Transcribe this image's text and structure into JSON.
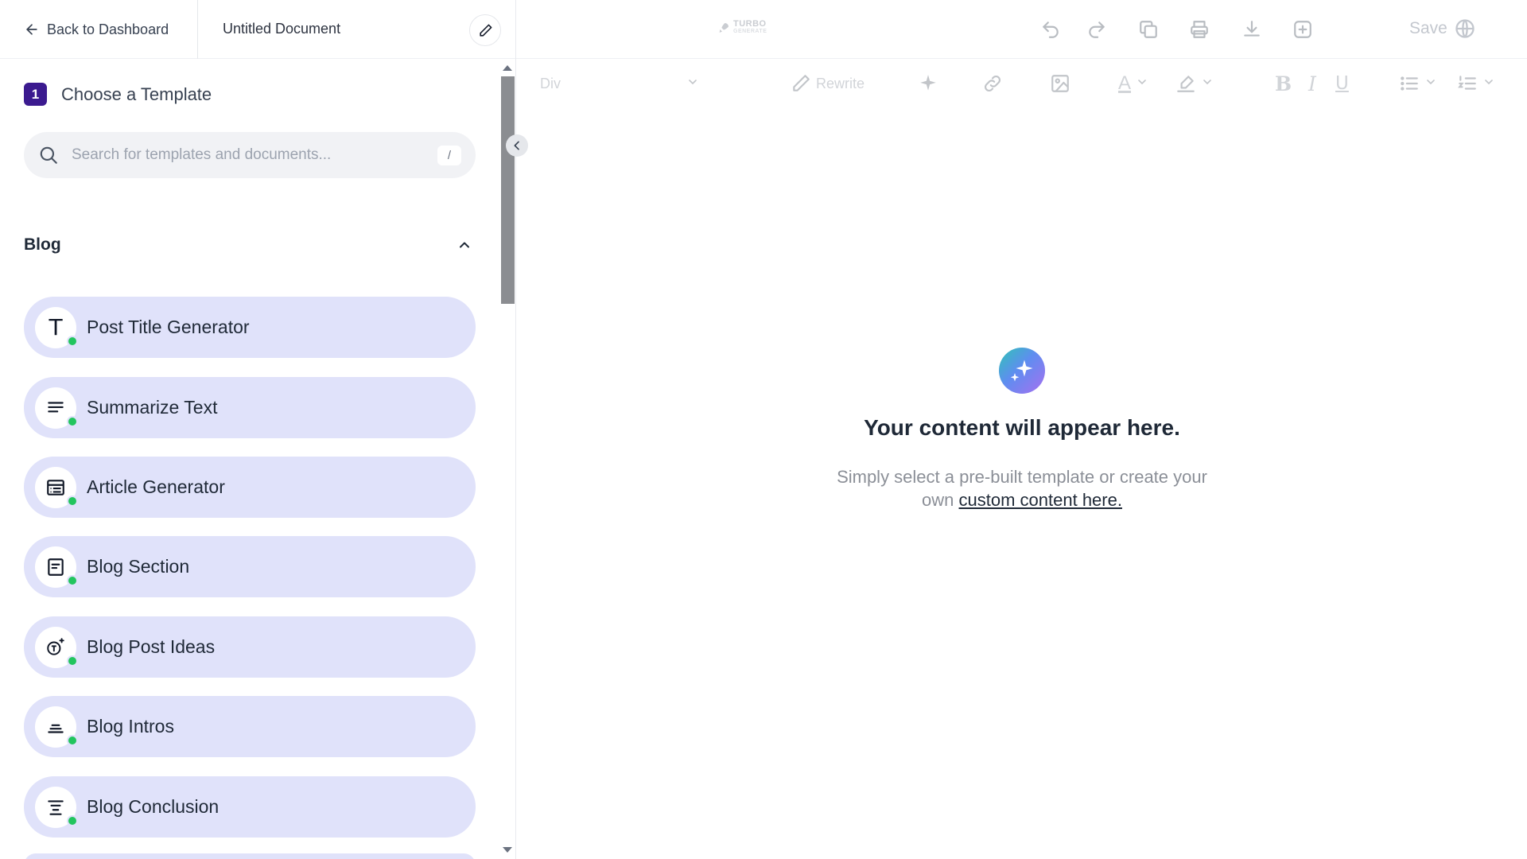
{
  "header": {
    "back_label": "Back to Dashboard",
    "document_title": "Untitled Document",
    "brand_line1": "TURBO",
    "brand_line2": "GENERATE",
    "save_label": "Save"
  },
  "toolbar": {
    "block_type": "Div",
    "rewrite_label": "Rewrite",
    "bold": "B",
    "italic": "I",
    "underline": "U",
    "text_color_glyph": "A"
  },
  "sidebar": {
    "step_number": "1",
    "step_title": "Choose a Template",
    "search_placeholder": "Search for templates and documents...",
    "search_shortcut": "/",
    "section_title": "Blog",
    "templates": [
      {
        "label": "Post Title Generator",
        "icon": "text-t-icon"
      },
      {
        "label": "Summarize Text",
        "icon": "align-lines-icon"
      },
      {
        "label": "Article Generator",
        "icon": "layout-icon"
      },
      {
        "label": "Blog Section",
        "icon": "document-section-icon"
      },
      {
        "label": "Blog Post Ideas",
        "icon": "sparkle-idea-icon"
      },
      {
        "label": "Blog Intros",
        "icon": "intro-lines-icon"
      },
      {
        "label": "Blog Conclusion",
        "icon": "filter-lines-icon"
      }
    ],
    "status_color": "#22c55e",
    "item_color": "#e0e2fa",
    "accent_color": "#3b1a8f"
  },
  "empty_state": {
    "title": "Your content will appear here.",
    "description": "Simply select a pre-built template or create your own",
    "link_text": "custom content here."
  }
}
